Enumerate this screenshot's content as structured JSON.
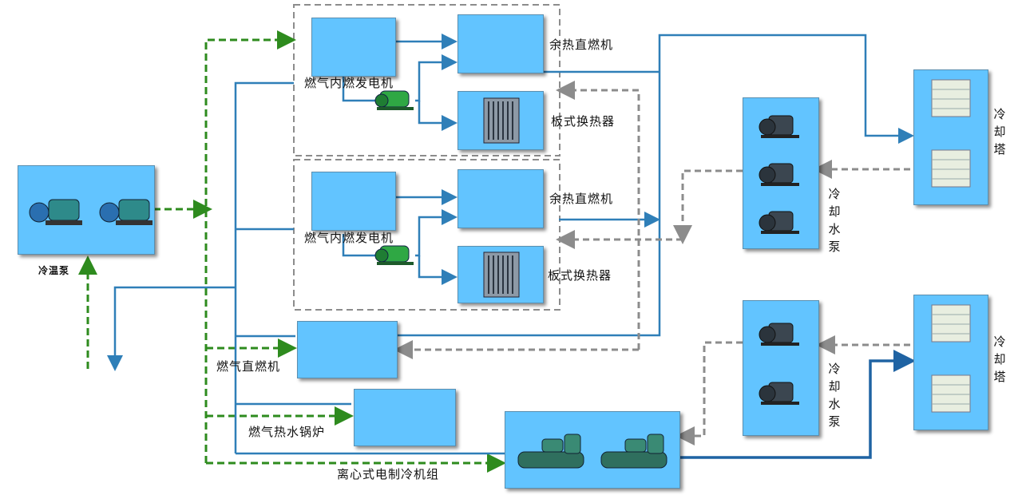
{
  "labels": {
    "pump_left": "冷温泵",
    "gen1": "燃气内燃发电机",
    "gen2": "燃气内燃发电机",
    "waste_heat1": "余热直燃机",
    "waste_heat2": "余热直燃机",
    "plate_hx1": "板式换热器",
    "plate_hx2": "板式换热器",
    "direct_fired": "燃气直燃机",
    "boiler": "燃气热水锅炉",
    "chiller": "离心式电制冷机组",
    "cw_pump_top": "冷却水泵",
    "cw_pump_bottom": "冷却水泵",
    "tower_top": "冷却塔",
    "tower_bottom": "冷却塔"
  },
  "colors": {
    "box_fill": "#62c4ff",
    "solid_line": "#2f7fb8",
    "solid_line_dark": "#1f63a3",
    "green_dashed": "#2e8b1e",
    "gray_dashed": "#8c8c8c"
  }
}
